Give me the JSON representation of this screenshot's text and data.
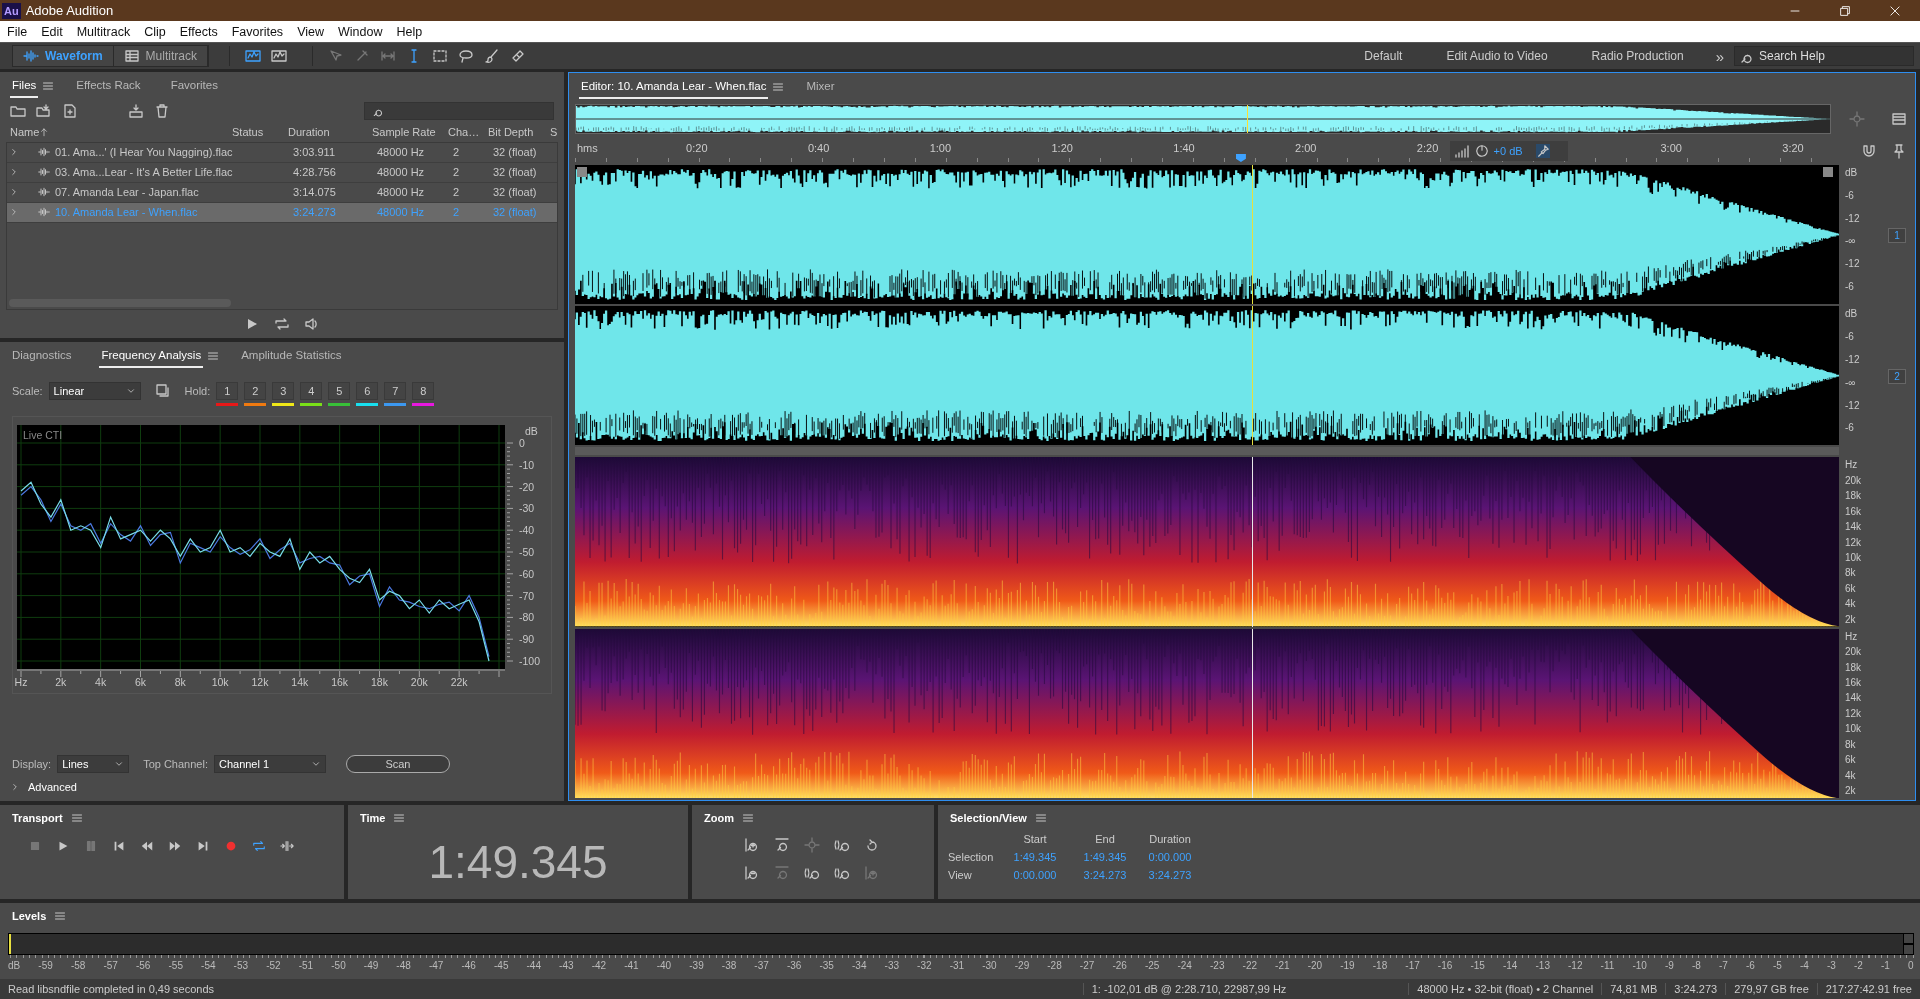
{
  "title_bar": {
    "logo": "Au",
    "app_name": "Adobe Audition"
  },
  "menu": [
    "File",
    "Edit",
    "Multitrack",
    "Clip",
    "Effects",
    "Favorites",
    "View",
    "Window",
    "Help"
  ],
  "toolbar": {
    "modes": [
      {
        "label": "Waveform",
        "selected": true
      },
      {
        "label": "Multitrack",
        "selected": false
      }
    ],
    "workspaces": [
      "Default",
      "Edit Audio to Video",
      "Radio Production"
    ],
    "overflow": "»",
    "search": {
      "placeholder": "Search Help"
    }
  },
  "files_panel": {
    "tabs": [
      {
        "label": "Files",
        "selected": true
      },
      {
        "label": "Effects Rack",
        "selected": false
      },
      {
        "label": "Favorites",
        "selected": false
      }
    ],
    "columns": [
      "Name",
      "Status",
      "Duration",
      "Sample Rate",
      "Cha…",
      "Bit Depth",
      "S"
    ],
    "rows": [
      {
        "name": "01. Ama...' (I Hear You Nagging).flac",
        "duration": "3:03.911",
        "sample_rate": "48000 Hz",
        "channels": "2",
        "bit_depth": "32 (float)",
        "selected": false
      },
      {
        "name": "03. Ama...Lear - It's A Better Life.flac",
        "duration": "4:28.756",
        "sample_rate": "48000 Hz",
        "channels": "2",
        "bit_depth": "32 (float)",
        "selected": false
      },
      {
        "name": "07. Amanda Lear - Japan.flac",
        "duration": "3:14.075",
        "sample_rate": "48000 Hz",
        "channels": "2",
        "bit_depth": "32 (float)",
        "selected": false
      },
      {
        "name": "10. Amanda Lear - When.flac",
        "duration": "3:24.273",
        "sample_rate": "48000 Hz",
        "channels": "2",
        "bit_depth": "32 (float)",
        "selected": true
      }
    ]
  },
  "freq_panel": {
    "tabs": [
      {
        "label": "Diagnostics",
        "selected": false
      },
      {
        "label": "Frequency Analysis",
        "selected": true
      },
      {
        "label": "Amplitude Statistics",
        "selected": false
      }
    ],
    "scale": {
      "label": "Scale:",
      "value": "Linear"
    },
    "hold": {
      "label": "Hold:",
      "buttons": [
        {
          "label": "1",
          "color": "#e81818"
        },
        {
          "label": "2",
          "color": "#f07a10"
        },
        {
          "label": "3",
          "color": "#f0e818"
        },
        {
          "label": "4",
          "color": "#7ae018"
        },
        {
          "label": "5",
          "color": "#38c038"
        },
        {
          "label": "6",
          "color": "#18e0f0"
        },
        {
          "label": "7",
          "color": "#3c98f0"
        },
        {
          "label": "8",
          "color": "#e818e0"
        }
      ]
    },
    "chart": {
      "overlay_label": "Live CTI",
      "chart_data": {
        "type": "line",
        "ylabel": "dB",
        "grid": true,
        "x": [
          0,
          500,
          1000,
          1500,
          2000,
          2500,
          3000,
          3500,
          4000,
          4500,
          5000,
          5500,
          6000,
          6500,
          7000,
          7500,
          8000,
          8500,
          9000,
          9500,
          10000,
          10500,
          11000,
          11500,
          12000,
          12500,
          13000,
          13500,
          14000,
          14500,
          15000,
          15500,
          16000,
          16500,
          17000,
          17500,
          18000,
          18500,
          19000,
          19500,
          20000,
          20500,
          21000,
          21500,
          22000,
          22500,
          23000,
          23500
        ],
        "series": [
          {
            "color": "#78dce8",
            "values": [
              -22,
              -18,
              -28,
              -34,
              -26,
              -40,
              -38,
              -40,
              -48,
              -34,
              -44,
              -42,
              -40,
              -45,
              -40,
              -44,
              -52,
              -44,
              -50,
              -48,
              -40,
              -50,
              -48,
              -52,
              -46,
              -50,
              -52,
              -44,
              -58,
              -50,
              -55,
              -52,
              -58,
              -62,
              -64,
              -58,
              -72,
              -68,
              -70,
              -76,
              -72,
              -78,
              -72,
              -76,
              -74,
              -72,
              -82,
              -100
            ]
          },
          {
            "color": "#4a78e0",
            "values": [
              -24,
              -20,
              -26,
              -36,
              -28,
              -38,
              -40,
              -37,
              -46,
              -37,
              -42,
              -45,
              -38,
              -47,
              -42,
              -41,
              -55,
              -46,
              -48,
              -50,
              -43,
              -48,
              -51,
              -49,
              -44,
              -53,
              -49,
              -46,
              -55,
              -53,
              -52,
              -55,
              -56,
              -65,
              -61,
              -60,
              -75,
              -66,
              -72,
              -73,
              -75,
              -76,
              -74,
              -73,
              -77,
              -70,
              -80,
              -98
            ]
          }
        ],
        "xlim": [
          0,
          24000
        ],
        "ylim": [
          -100,
          0
        ],
        "xticks": [
          {
            "value": 0,
            "label": "Hz"
          },
          {
            "value": 2000,
            "label": "2k"
          },
          {
            "value": 4000,
            "label": "4k"
          },
          {
            "value": 6000,
            "label": "6k"
          },
          {
            "value": 8000,
            "label": "8k"
          },
          {
            "value": 10000,
            "label": "10k"
          },
          {
            "value": 12000,
            "label": "12k"
          },
          {
            "value": 14000,
            "label": "14k"
          },
          {
            "value": 16000,
            "label": "16k"
          },
          {
            "value": 18000,
            "label": "18k"
          },
          {
            "value": 20000,
            "label": "20k"
          },
          {
            "value": 22000,
            "label": "22k"
          }
        ],
        "yticks": [
          0,
          -10,
          -20,
          -30,
          -40,
          -50,
          -60,
          -70,
          -80,
          -90,
          -100
        ]
      }
    },
    "display": {
      "label": "Display:",
      "value": "Lines"
    },
    "top_channel": {
      "label": "Top Channel:",
      "value": "Channel 1"
    },
    "scan_button": "Scan",
    "advanced": {
      "label": "Advanced",
      "expanded": false
    }
  },
  "editor": {
    "tabs": [
      {
        "label": "Editor: 10. Amanda Lear - When.flac",
        "selected": true
      },
      {
        "label": "Mixer",
        "selected": false
      }
    ],
    "playhead": {
      "level": 0.5353
    },
    "ruler": {
      "unit": "hms",
      "labels": [
        "0:20",
        "0:40",
        "1:00",
        "1:20",
        "1:40",
        "2:00",
        "2:20",
        "3:00",
        "3:20"
      ]
    },
    "gain_hud": {
      "value": "+0 dB"
    },
    "channels": [
      {
        "badge": "1",
        "db_labels": [
          "dB",
          "-6",
          "-12",
          "-∞",
          "-12",
          "-6"
        ]
      },
      {
        "badge": "2",
        "db_labels": [
          "dB",
          "-6",
          "-12",
          "-∞",
          "-12",
          "-6"
        ]
      }
    ],
    "spectral_channels": [
      {
        "hz_labels": [
          "Hz",
          "20k",
          "18k",
          "16k",
          "14k",
          "12k",
          "10k",
          "8k",
          "6k",
          "4k",
          "2k"
        ]
      },
      {
        "hz_labels": [
          "Hz",
          "20k",
          "18k",
          "16k",
          "14k",
          "12k",
          "10k",
          "8k",
          "6k",
          "4k",
          "2k"
        ]
      }
    ]
  },
  "transport": {
    "title": "Transport",
    "loop_on": true
  },
  "time": {
    "title": "Time",
    "value": "1:49.345"
  },
  "zoom": {
    "title": "Zoom"
  },
  "selection_view": {
    "title": "Selection/View",
    "columns": [
      "Start",
      "End",
      "Duration"
    ],
    "rows": [
      {
        "label": "Selection",
        "start": "1:49.345",
        "end": "1:49.345",
        "duration": "0:00.000"
      },
      {
        "label": "View",
        "start": "0:00.000",
        "end": "3:24.273",
        "duration": "3:24.273"
      }
    ]
  },
  "levels": {
    "title": "Levels",
    "scale": [
      "dB",
      "-59",
      "-58",
      "-57",
      "-56",
      "-55",
      "-54",
      "-53",
      "-52",
      "-51",
      "-50",
      "-49",
      "-48",
      "-47",
      "-46",
      "-45",
      "-44",
      "-43",
      "-42",
      "-41",
      "-40",
      "-39",
      "-38",
      "-37",
      "-36",
      "-35",
      "-34",
      "-33",
      "-32",
      "-31",
      "-30",
      "-29",
      "-28",
      "-27",
      "-26",
      "-25",
      "-24",
      "-23",
      "-22",
      "-21",
      "-20",
      "-19",
      "-18",
      "-17",
      "-16",
      "-15",
      "-14",
      "-13",
      "-12",
      "-11",
      "-10",
      "-9",
      "-8",
      "-7",
      "-6",
      "-5",
      "-4",
      "-3",
      "-2",
      "-1",
      "0"
    ]
  },
  "status_bar": {
    "message": "Read libsndfile completed in 0,49 seconds",
    "cursor": "1: -102,01 dB @ 2:28.710, 22987,99 Hz",
    "format": "48000 Hz • 32-bit (float) • 2 Channel",
    "size": "74,81 MB",
    "duration": "3:24.273",
    "disk_free": "279,97 GB free",
    "time_free": "217:27:42.91 free"
  }
}
